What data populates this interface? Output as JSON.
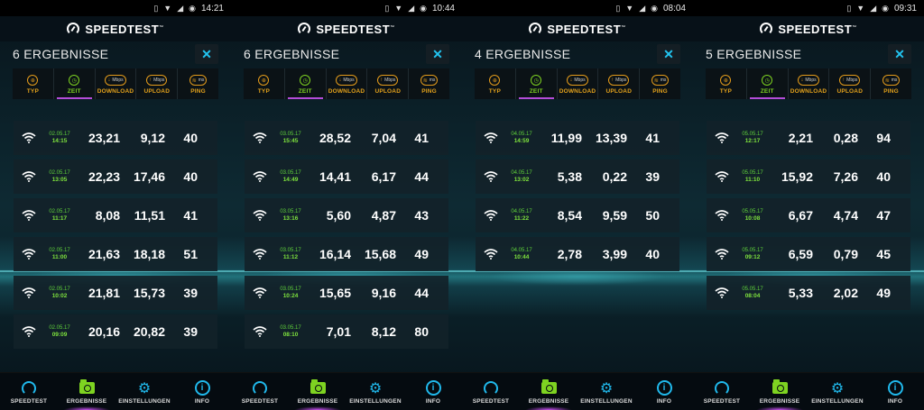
{
  "app": {
    "title": "SPEEDTEST",
    "trademark": "™"
  },
  "columns": [
    {
      "label": "TYP",
      "icon": "globe-icon",
      "unit": ""
    },
    {
      "label": "ZEIT",
      "icon": "clock-icon",
      "unit": ""
    },
    {
      "label": "DOWNLOAD",
      "icon": "download-icon",
      "unit": "Mbps"
    },
    {
      "label": "UPLOAD",
      "icon": "upload-icon",
      "unit": "Mbps"
    },
    {
      "label": "PING",
      "icon": "ping-icon",
      "unit": "ms"
    }
  ],
  "nav": [
    {
      "label": "SPEEDTEST",
      "icon": "gauge-icon"
    },
    {
      "label": "ERGEBNISSE",
      "icon": "folder-icon"
    },
    {
      "label": "EINSTELLUNGEN",
      "icon": "gear-icon"
    },
    {
      "label": "INFO",
      "icon": "info-icon"
    }
  ],
  "colors": {
    "accent": "#20b9ec",
    "active": "#7ed321",
    "highlight": "#b44cd8",
    "column_label": "#e3a11b"
  },
  "panels": [
    {
      "time": "14:21",
      "results_label": "6 ERGEBNISSE",
      "rows": [
        {
          "date": "02.05.17",
          "time": "14:15",
          "download": "23,21",
          "upload": "9,12",
          "ping": "40"
        },
        {
          "date": "02.05.17",
          "time": "13:05",
          "download": "22,23",
          "upload": "17,46",
          "ping": "40"
        },
        {
          "date": "02.05.17",
          "time": "11:17",
          "download": "8,08",
          "upload": "11,51",
          "ping": "41"
        },
        {
          "date": "02.05.17",
          "time": "11:00",
          "download": "21,63",
          "upload": "18,18",
          "ping": "51"
        },
        {
          "date": "02.05.17",
          "time": "10:02",
          "download": "21,81",
          "upload": "15,73",
          "ping": "39"
        },
        {
          "date": "02.05.17",
          "time": "09:09",
          "download": "20,16",
          "upload": "20,82",
          "ping": "39"
        }
      ]
    },
    {
      "time": "10:44",
      "results_label": "6 ERGEBNISSE",
      "rows": [
        {
          "date": "03.05.17",
          "time": "15:45",
          "download": "28,52",
          "upload": "7,04",
          "ping": "41"
        },
        {
          "date": "03.05.17",
          "time": "14:49",
          "download": "14,41",
          "upload": "6,17",
          "ping": "44"
        },
        {
          "date": "03.05.17",
          "time": "13:16",
          "download": "5,60",
          "upload": "4,87",
          "ping": "43"
        },
        {
          "date": "03.05.17",
          "time": "11:12",
          "download": "16,14",
          "upload": "15,68",
          "ping": "49"
        },
        {
          "date": "03.05.17",
          "time": "10:24",
          "download": "15,65",
          "upload": "9,16",
          "ping": "44"
        },
        {
          "date": "03.05.17",
          "time": "08:10",
          "download": "7,01",
          "upload": "8,12",
          "ping": "80"
        }
      ]
    },
    {
      "time": "08:04",
      "results_label": "4 ERGEBNISSE",
      "rows": [
        {
          "date": "04.05.17",
          "time": "14:59",
          "download": "11,99",
          "upload": "13,39",
          "ping": "41"
        },
        {
          "date": "04.05.17",
          "time": "13:02",
          "download": "5,38",
          "upload": "0,22",
          "ping": "39"
        },
        {
          "date": "04.05.17",
          "time": "11:22",
          "download": "8,54",
          "upload": "9,59",
          "ping": "50"
        },
        {
          "date": "04.05.17",
          "time": "10:44",
          "download": "2,78",
          "upload": "3,99",
          "ping": "40"
        }
      ]
    },
    {
      "time": "09:31",
      "results_label": "5 ERGEBNISSE",
      "rows": [
        {
          "date": "05.05.17",
          "time": "12:17",
          "download": "2,21",
          "upload": "0,28",
          "ping": "94"
        },
        {
          "date": "05.05.17",
          "time": "11:10",
          "download": "15,92",
          "upload": "7,26",
          "ping": "40"
        },
        {
          "date": "05.05.17",
          "time": "10:08",
          "download": "6,67",
          "upload": "4,74",
          "ping": "47"
        },
        {
          "date": "05.05.17",
          "time": "09:12",
          "download": "6,59",
          "upload": "0,79",
          "ping": "45"
        },
        {
          "date": "05.05.17",
          "time": "08:04",
          "download": "5,33",
          "upload": "2,02",
          "ping": "49"
        }
      ]
    }
  ]
}
